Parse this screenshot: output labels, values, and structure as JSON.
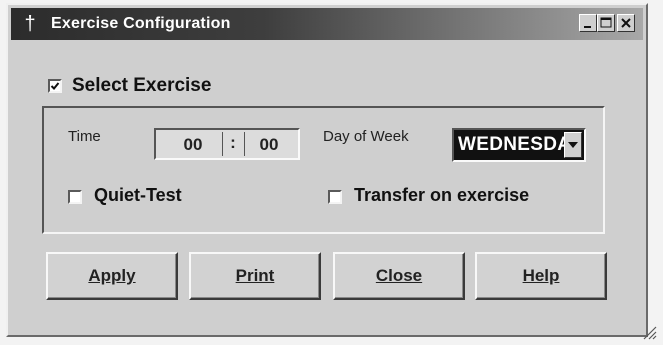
{
  "window": {
    "title": "Exercise Configuration",
    "icon": "pin-icon",
    "controls": [
      "minimize-icon",
      "maximize-icon",
      "close-icon"
    ]
  },
  "select_exercise": {
    "label": "Select Exercise",
    "checked": true
  },
  "fields": {
    "time_label": "Time",
    "time_hours": "00",
    "time_separator": ":",
    "time_minutes": "00",
    "day_label": "Day of Week",
    "day_value": "WEDNESDAY"
  },
  "options": {
    "quiet_test_label": "Quiet-Test",
    "quiet_test_checked": false,
    "transfer_label": "Transfer on exercise",
    "transfer_checked": false
  },
  "buttons": {
    "apply": "Apply",
    "print": "Print",
    "close": "Close",
    "help": "Help"
  }
}
